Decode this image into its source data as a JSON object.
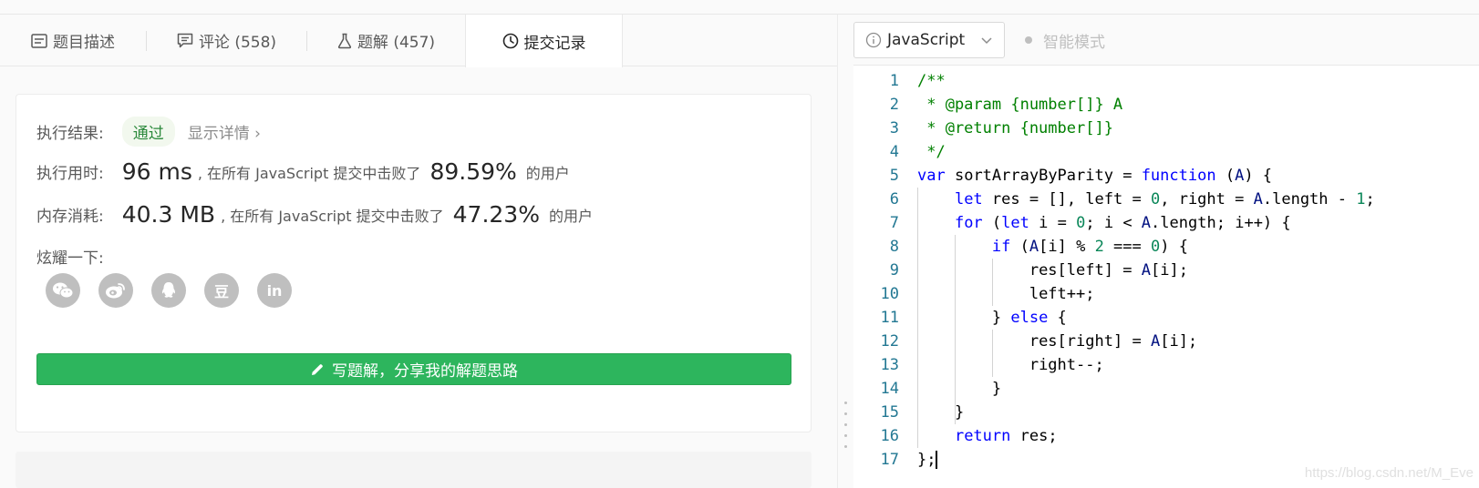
{
  "tabs": [
    {
      "label": "题目描述",
      "icon": "description-icon"
    },
    {
      "label": "评论 (558)",
      "icon": "comment-icon"
    },
    {
      "label": "题解 (457)",
      "icon": "flask-icon"
    },
    {
      "label": "提交记录",
      "icon": "clock-icon",
      "active": true
    }
  ],
  "result": {
    "label": "执行结果:",
    "status": "通过",
    "details": "显示详情 ›"
  },
  "runtime": {
    "label": "执行用时:",
    "value": "96 ms",
    "text_before": ", 在所有 JavaScript 提交中击败了",
    "percent": "89.59%",
    "text_after": "的用户"
  },
  "memory": {
    "label": "内存消耗:",
    "value": "40.3 MB",
    "text_before": ", 在所有 JavaScript 提交中击败了",
    "percent": "47.23%",
    "text_after": "的用户"
  },
  "share": {
    "label": "炫耀一下:",
    "icons": [
      "wechat-icon",
      "weibo-icon",
      "qq-icon",
      "douban-icon",
      "linkedin-icon"
    ],
    "douban_text": "豆",
    "linkedin_text": "in"
  },
  "write_button": "写题解，分享我的解题思路",
  "editor": {
    "language": "JavaScript",
    "mode": "智能模式",
    "line_numbers": [
      "1",
      "2",
      "3",
      "4",
      "5",
      "6",
      "7",
      "8",
      "9",
      "10",
      "11",
      "12",
      "13",
      "14",
      "15",
      "16",
      "17"
    ],
    "lines": [
      "/**",
      " * @param {number[]} A",
      " * @return {number[]}",
      " */",
      "var sortArrayByParity = function (A) {",
      "    let res = [], left = 0, right = A.length - 1;",
      "    for (let i = 0; i < A.length; i++) {",
      "        if (A[i] % 2 === 0) {",
      "            res[left] = A[i];",
      "            left++;",
      "        } else {",
      "            res[right] = A[i];",
      "            right--;",
      "        }",
      "    }",
      "    return res;",
      "};"
    ]
  },
  "watermark": "https://blog.csdn.net/M_Eve",
  "colors": {
    "accent_green": "#2db55d",
    "line_number": "#237893",
    "comment": "#008000",
    "keyword": "#0000ff",
    "number": "#098658"
  }
}
